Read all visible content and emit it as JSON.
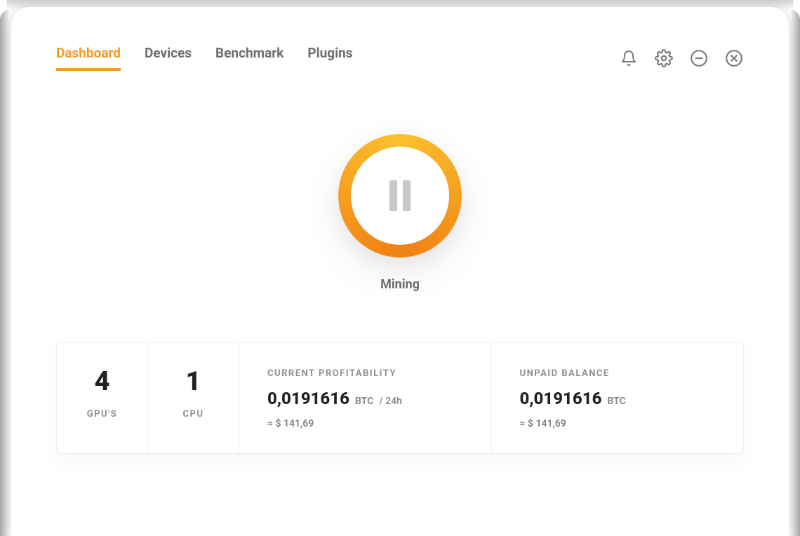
{
  "nav": {
    "tabs": [
      {
        "label": "Dashboard",
        "active": true
      },
      {
        "label": "Devices",
        "active": false
      },
      {
        "label": "Benchmark",
        "active": false
      },
      {
        "label": "Plugins",
        "active": false
      }
    ]
  },
  "mining": {
    "status_label": "Mining"
  },
  "stats": {
    "gpu": {
      "count": "4",
      "label": "GPU'S"
    },
    "cpu": {
      "count": "1",
      "label": "CPU"
    },
    "profitability": {
      "title": "CURRENT PROFITABILITY",
      "btc_value": "0,0191616",
      "btc_unit": "BTC",
      "per": "/ 24h",
      "approx": "≈ $ 141,69"
    },
    "balance": {
      "title": "UNPAID BALANCE",
      "btc_value": "0,0191616",
      "btc_unit": "BTC",
      "approx": "≈ $ 141,69"
    }
  }
}
